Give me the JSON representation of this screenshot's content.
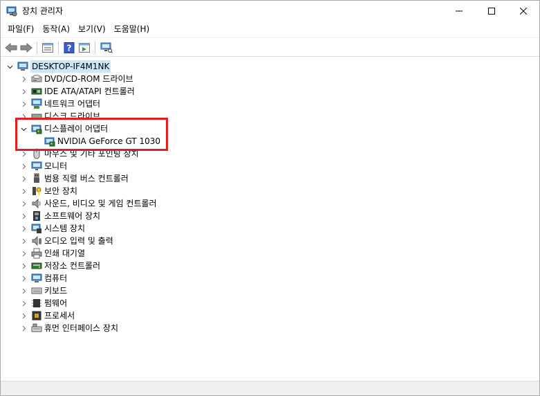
{
  "window": {
    "title": "장치 관리자",
    "icon": "device-manager-icon",
    "controls": {
      "minimize": "minimize-icon",
      "maximize": "maximize-icon",
      "close": "close-icon"
    }
  },
  "menu": {
    "items": [
      {
        "label": "파일(F)"
      },
      {
        "label": "동작(A)"
      },
      {
        "label": "보기(V)"
      },
      {
        "label": "도움말(H)"
      }
    ]
  },
  "toolbar": {
    "buttons": [
      "back-arrow-icon",
      "forward-arrow-icon",
      "properties-icon",
      "help-icon",
      "update-driver-icon",
      "scan-hardware-icon"
    ]
  },
  "tree": {
    "root": {
      "label": "DESKTOP-IF4M1NK",
      "icon": "computer-icon",
      "expanded": true,
      "selected": true
    },
    "categories": [
      {
        "label": "DVD/CD-ROM 드라이브",
        "icon": "dvd-drive-icon"
      },
      {
        "label": "IDE ATA/ATAPI 컨트롤러",
        "icon": "ide-controller-icon"
      },
      {
        "label": "네트워크 어댑터",
        "icon": "network-adapter-icon"
      },
      {
        "label": "디스크 드라이브",
        "icon": "disk-drive-icon"
      },
      {
        "label": "디스플레이 어댑터",
        "icon": "display-adapter-icon",
        "expanded": true,
        "children": [
          {
            "label": "NVIDIA GeForce GT 1030",
            "icon": "display-adapter-icon"
          }
        ]
      },
      {
        "label": "마우스 및 기타 포인팅 장치",
        "icon": "mouse-icon"
      },
      {
        "label": "모니터",
        "icon": "monitor-icon"
      },
      {
        "label": "범용 직렬 버스 컨트롤러",
        "icon": "usb-icon"
      },
      {
        "label": "보안 장치",
        "icon": "security-key-icon"
      },
      {
        "label": "사운드, 비디오 및 게임 컨트롤러",
        "icon": "speaker-icon"
      },
      {
        "label": "소프트웨어 장치",
        "icon": "software-device-icon"
      },
      {
        "label": "시스템 장치",
        "icon": "system-device-icon"
      },
      {
        "label": "오디오 입력 및 출력",
        "icon": "audio-io-icon"
      },
      {
        "label": "인쇄 대기열",
        "icon": "printer-icon"
      },
      {
        "label": "저장소 컨트롤러",
        "icon": "storage-controller-icon"
      },
      {
        "label": "컴퓨터",
        "icon": "computer-icon"
      },
      {
        "label": "키보드",
        "icon": "keyboard-icon"
      },
      {
        "label": "펌웨어",
        "icon": "firmware-icon"
      },
      {
        "label": "프로세서",
        "icon": "processor-icon"
      },
      {
        "label": "휴먼 인터페이스 장치",
        "icon": "hid-icon"
      }
    ]
  },
  "annotation": {
    "color": "#e02020"
  },
  "colors": {
    "selection": "#cce8ff",
    "accent": "#1f6fbf"
  }
}
